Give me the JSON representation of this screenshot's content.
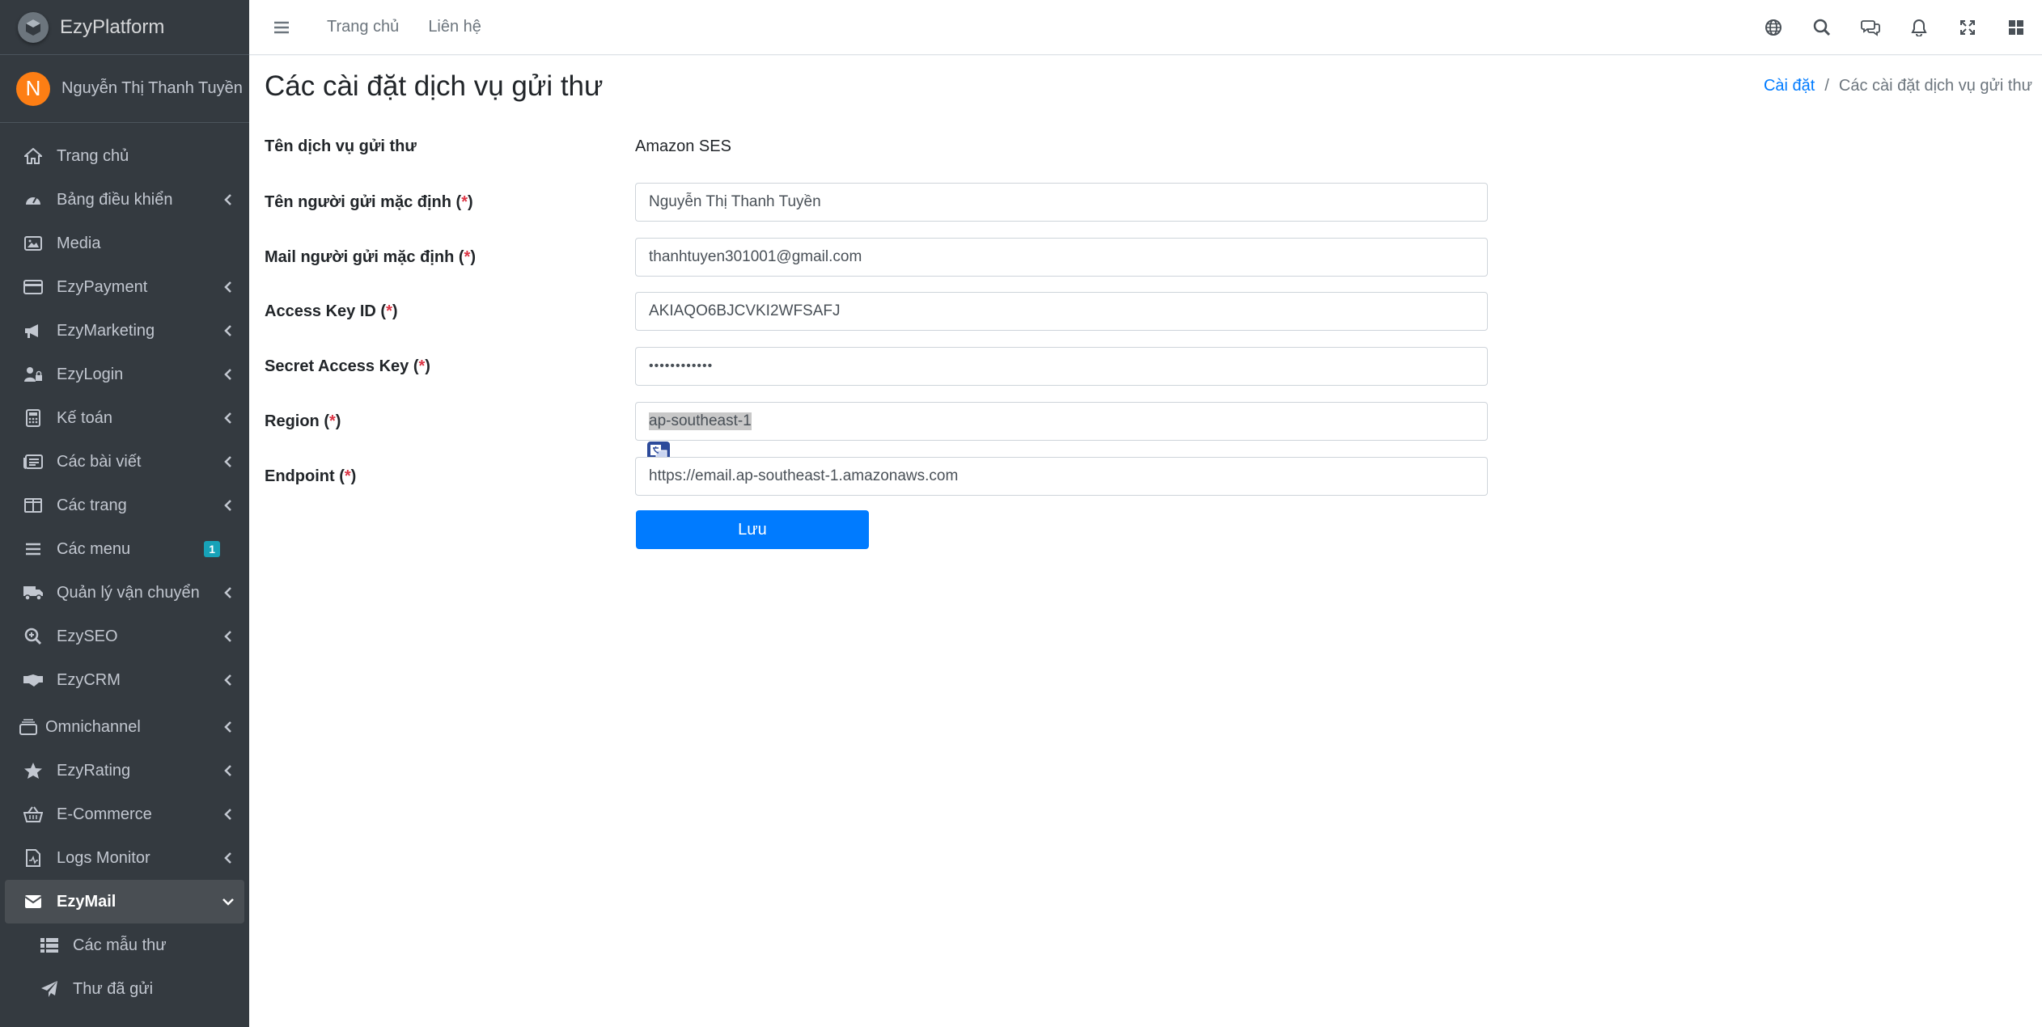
{
  "brand": {
    "name": "EzyPlatform"
  },
  "user": {
    "initial": "N",
    "name": "Nguyễn Thị Thanh Tuyền"
  },
  "sidebar": {
    "items": [
      {
        "label": "Trang chủ",
        "icon": "home-icon"
      },
      {
        "label": "Bảng điều khiển",
        "icon": "dashboard-icon"
      },
      {
        "label": "Media",
        "icon": "image-icon"
      },
      {
        "label": "EzyPayment",
        "icon": "credit-card-icon"
      },
      {
        "label": "EzyMarketing",
        "icon": "megaphone-icon"
      },
      {
        "label": "EzyLogin",
        "icon": "user-lock-icon"
      },
      {
        "label": "Kế toán",
        "icon": "calculator-icon"
      },
      {
        "label": "Các bài viết",
        "icon": "newspaper-icon"
      },
      {
        "label": "Các trang",
        "icon": "columns-icon"
      },
      {
        "label": "Các menu",
        "icon": "bars-icon",
        "badge": "1"
      },
      {
        "label": "Quản lý vận chuyển",
        "icon": "truck-icon"
      },
      {
        "label": "EzySEO",
        "icon": "search-plus-icon"
      },
      {
        "label": "EzyCRM",
        "icon": "handshake-icon"
      },
      {
        "label": "Omnichannel",
        "icon": "layers-icon"
      },
      {
        "label": "EzyRating",
        "icon": "star-icon"
      },
      {
        "label": "E-Commerce",
        "icon": "basket-icon"
      },
      {
        "label": "Logs Monitor",
        "icon": "file-medical-icon"
      },
      {
        "label": "EzyMail",
        "icon": "envelope-icon"
      },
      {
        "label": "Các mẫu thư",
        "icon": "table-icon"
      },
      {
        "label": "Thư đã gửi",
        "icon": "paper-plane-icon"
      }
    ]
  },
  "topbar": {
    "links": [
      "Trang chủ",
      "Liên hệ"
    ]
  },
  "page": {
    "title": "Các cài đặt dịch vụ gửi thư",
    "breadcrumb": {
      "parent": "Cài đặt",
      "separator": "/",
      "current": "Các cài đặt dịch vụ gửi thư"
    }
  },
  "form": {
    "service_label": "Tên dịch vụ gửi thư",
    "service_value": "Amazon SES",
    "sender_name_label": "Tên người gửi mặc định (",
    "sender_name_value": "Nguyễn Thị Thanh Tuyền",
    "sender_mail_label": "Mail người gửi mặc định (",
    "sender_mail_value": "thanhtuyen301001@gmail.com",
    "access_key_label": "Access Key ID (",
    "access_key_value": "AKIAQO6BJCVKI2WFSAFJ",
    "secret_key_label": "Secret Access Key (",
    "secret_key_value": "••••••••••••",
    "region_label": "Region (",
    "region_value": "ap-southeast-1",
    "endpoint_label": "Endpoint (",
    "endpoint_value": "https://email.ap-southeast-1.amazonaws.com",
    "required_mark": "*",
    "close_paren": ")",
    "save_label": "Lưu"
  },
  "colors": {
    "primary": "#007bff",
    "sidebar_bg": "#343a40",
    "required": "#dc3545",
    "avatar": "#fd7e14",
    "badge": "#17a2b8"
  }
}
